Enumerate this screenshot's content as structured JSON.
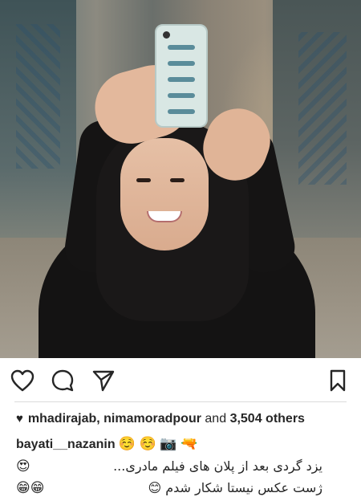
{
  "post": {
    "likers_label": "mhadirajab, nimamoradpour",
    "likes_joiner": "and",
    "likes_count": "3,504 others",
    "username": "bayati__nazanin",
    "username_emoji": "☺️ ☺️ 📷 🔫",
    "caption_line1": "یزد گردی بعد از پلان های فیلم مادری...",
    "caption_line1_emoji": "😍",
    "caption_line2": "ژست عکس نیستا شکار شدم 😊",
    "caption_line2_emoji": "😁😁"
  },
  "icons": {
    "like": "heart-outline-icon",
    "comment": "comment-bubble-icon",
    "share": "paper-plane-icon",
    "save": "bookmark-icon",
    "liked": "heart-filled-icon"
  }
}
